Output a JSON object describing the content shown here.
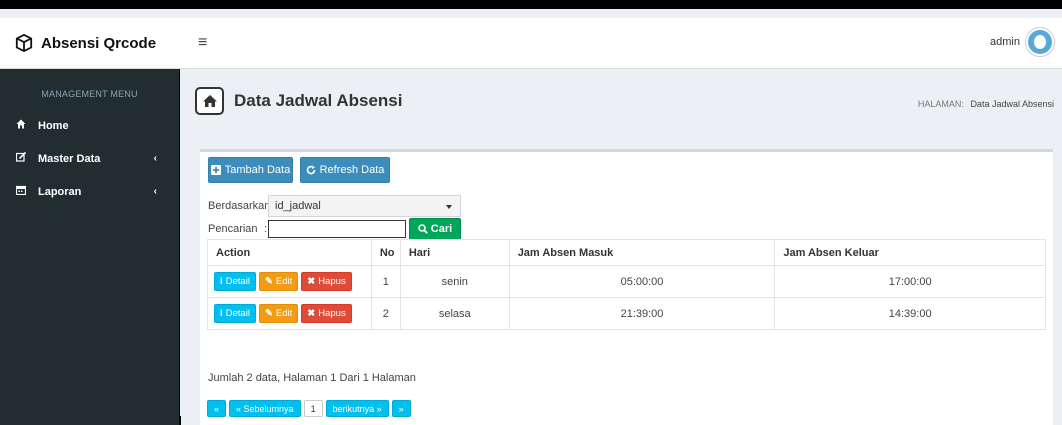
{
  "brand": {
    "title": "Absensi Qrcode",
    "icon": "cube-icon"
  },
  "navbar": {
    "menu_icon": "≡",
    "user": "admin"
  },
  "sidebar": {
    "header": "MANAGEMENT MENU",
    "items": [
      {
        "label": "Home",
        "icon": "home-icon",
        "has_children": false
      },
      {
        "label": "Master Data",
        "icon": "edit-icon",
        "has_children": true
      },
      {
        "label": "Laporan",
        "icon": "calendar-icon",
        "has_children": true
      }
    ]
  },
  "page": {
    "title": "Data Jadwal Absensi",
    "breadcrumb_label": "HALAMAN:",
    "breadcrumb_value": "Data Jadwal Absensi"
  },
  "toolbar": {
    "add_label": "Tambah Data",
    "refresh_label": "Refresh Data"
  },
  "filter": {
    "sort_label": "Berdasarkan",
    "sort_value": "id_jadwal",
    "search_label": "Pencarian",
    "search_value": "",
    "search_button": "Cari"
  },
  "table": {
    "columns": [
      "Action",
      "No",
      "Hari",
      "Jam Absen Masuk",
      "Jam Absen Keluar"
    ],
    "action_labels": {
      "detail": "Detail",
      "edit": "Edit",
      "delete": "Hapus"
    },
    "rows": [
      {
        "no": "1",
        "hari": "senin",
        "masuk": "05:00:00",
        "keluar": "17:00:00"
      },
      {
        "no": "2",
        "hari": "selasa",
        "masuk": "21:39:00",
        "keluar": "14:39:00"
      }
    ]
  },
  "summary": "Jumlah 2 data, Halaman 1 Dari 1 Halaman",
  "pagination": {
    "first": "«",
    "prev": "« Sebelumnya",
    "current": "1",
    "next": "berikutnya »",
    "last": "»"
  },
  "colors": {
    "primary": "#3c8dbc",
    "success": "#00a65a",
    "info": "#00c0ef",
    "warning": "#f39c12",
    "danger": "#dd4b39",
    "sidebar_bg": "#222d32"
  }
}
